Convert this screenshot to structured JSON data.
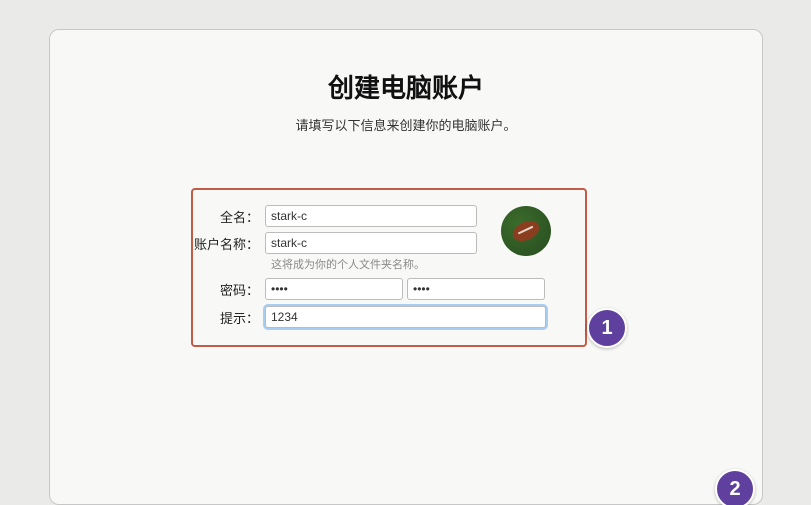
{
  "header": {
    "title": "创建电脑账户",
    "subtitle": "请填写以下信息来创建你的电脑账户。"
  },
  "form": {
    "full_name_label": "全名：",
    "full_name_value": "stark-c",
    "account_label": "账户名称：",
    "account_value": "stark-c",
    "account_note": "这将成为你的个人文件夹名称。",
    "password_label": "密码：",
    "password_value": "••••",
    "password_confirm_value": "••••",
    "hint_label": "提示：",
    "hint_value": "1234"
  },
  "avatar": {
    "icon": "football-icon"
  },
  "annotations": {
    "badge1": "1",
    "badge2": "2"
  }
}
